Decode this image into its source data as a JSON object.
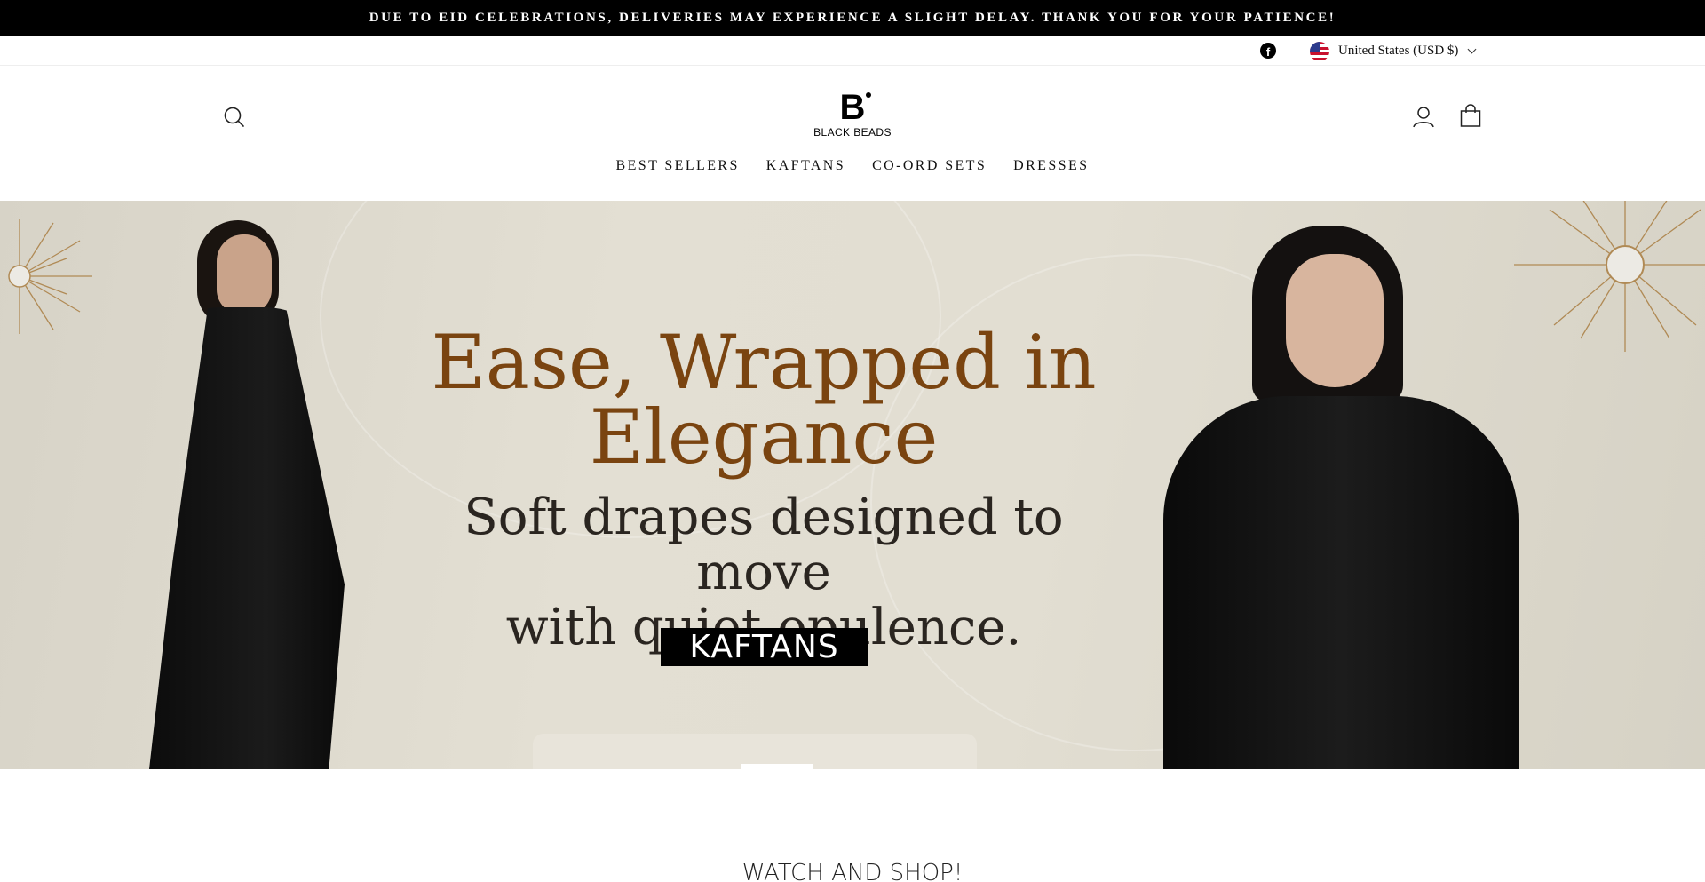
{
  "announcement": {
    "text": "DUE TO EID CELEBRATIONS, DELIVERIES MAY EXPERIENCE A SLIGHT DELAY. THANK YOU FOR YOUR PATIENCE!"
  },
  "utility": {
    "social_icon": "facebook-icon",
    "currency_label": "United States (USD $)"
  },
  "header": {
    "logo_mark": "B",
    "logo_text": "BLACK BEADS",
    "nav": [
      {
        "label": "BEST SELLERS"
      },
      {
        "label": "KAFTANS"
      },
      {
        "label": "CO-ORD SETS"
      },
      {
        "label": "DRESSES"
      }
    ]
  },
  "hero": {
    "title_line1": "Ease, Wrapped in",
    "title_line2": "Elegance",
    "subtitle_line1": "Soft drapes designed to move",
    "subtitle_line2": "with quiet opulence.",
    "cta_label": "KAFTANS",
    "title_color": "#7a4410"
  },
  "section": {
    "title": "WATCH AND SHOP!"
  }
}
